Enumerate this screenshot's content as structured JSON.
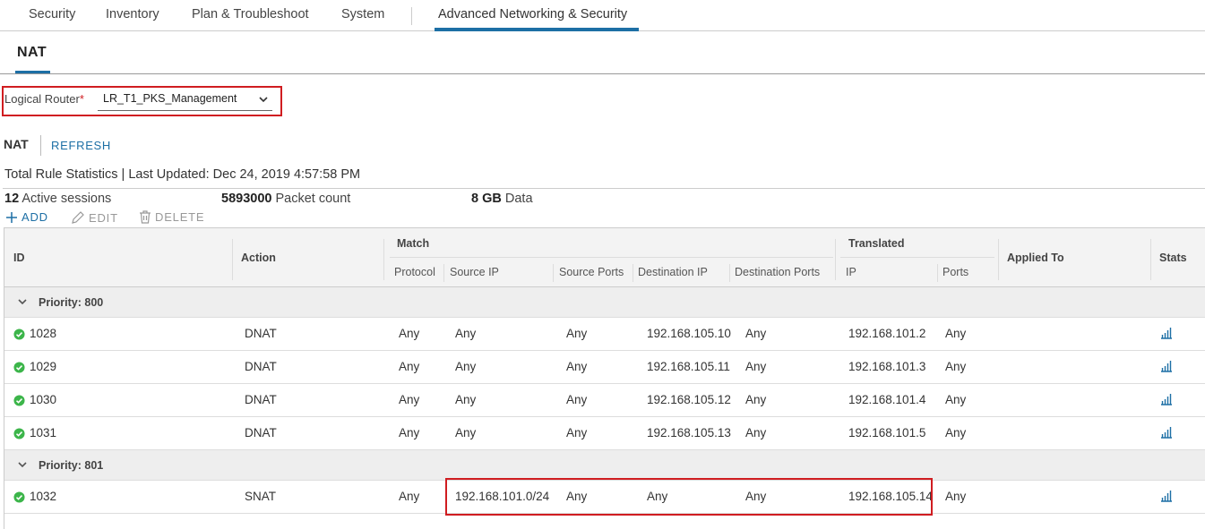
{
  "top_nav": {
    "tabs": [
      "Security",
      "Inventory",
      "Plan & Troubleshoot",
      "System",
      "Advanced Networking & Security"
    ],
    "active": "Advanced Networking & Security"
  },
  "sub_nav": {
    "title": "NAT"
  },
  "router": {
    "label": "Logical Router",
    "required_mark": "*",
    "value": "LR_T1_PKS_Management"
  },
  "section": {
    "title": "NAT",
    "refresh_label": "REFRESH"
  },
  "stats": {
    "title": "Total Rule Statistics | Last Updated: Dec 24, 2019 4:57:58 PM",
    "sessions_value": "12",
    "sessions_label": "Active sessions",
    "packets_value": "5893000",
    "packets_label": "Packet count",
    "data_value": "8 GB",
    "data_label": "Data"
  },
  "toolbar": {
    "add": "ADD",
    "edit": "EDIT",
    "delete": "DELETE"
  },
  "table": {
    "headers": {
      "id": "ID",
      "action": "Action",
      "match": "Match",
      "protocol": "Protocol",
      "source_ip": "Source IP",
      "source_ports": "Source Ports",
      "destination_ip": "Destination IP",
      "destination_ports": "Destination Ports",
      "translated": "Translated",
      "ip": "IP",
      "ports": "Ports",
      "applied_to": "Applied To",
      "stats": "Stats"
    },
    "groups": [
      {
        "label": "Priority: 800",
        "rows": [
          {
            "id": "1028",
            "action": "DNAT",
            "protocol": "Any",
            "source_ip": "Any",
            "source_ports": "Any",
            "destination_ip": "192.168.105.10",
            "destination_ports": "Any",
            "translated_ip": "192.168.101.2",
            "translated_ports": "Any"
          },
          {
            "id": "1029",
            "action": "DNAT",
            "protocol": "Any",
            "source_ip": "Any",
            "source_ports": "Any",
            "destination_ip": "192.168.105.11",
            "destination_ports": "Any",
            "translated_ip": "192.168.101.3",
            "translated_ports": "Any"
          },
          {
            "id": "1030",
            "action": "DNAT",
            "protocol": "Any",
            "source_ip": "Any",
            "source_ports": "Any",
            "destination_ip": "192.168.105.12",
            "destination_ports": "Any",
            "translated_ip": "192.168.101.4",
            "translated_ports": "Any"
          },
          {
            "id": "1031",
            "action": "DNAT",
            "protocol": "Any",
            "source_ip": "Any",
            "source_ports": "Any",
            "destination_ip": "192.168.105.13",
            "destination_ports": "Any",
            "translated_ip": "192.168.101.5",
            "translated_ports": "Any"
          }
        ]
      },
      {
        "label": "Priority: 801",
        "rows": [
          {
            "id": "1032",
            "action": "SNAT",
            "protocol": "Any",
            "source_ip": "192.168.101.0/24",
            "source_ports": "Any",
            "destination_ip": "Any",
            "destination_ports": "Any",
            "translated_ip": "192.168.105.14",
            "translated_ports": "Any"
          }
        ]
      }
    ]
  },
  "colors": {
    "accent": "#1d6fa5",
    "highlight_border": "#d01d21",
    "status_ok": "#3cb54a"
  },
  "icons": {
    "status": "check-circle-icon",
    "stats": "bar-chart-icon",
    "group_toggle": "chevron-down-icon",
    "router_dropdown": "chevron-down-icon",
    "add": "plus-icon",
    "edit": "pencil-icon",
    "delete": "trash-icon"
  }
}
